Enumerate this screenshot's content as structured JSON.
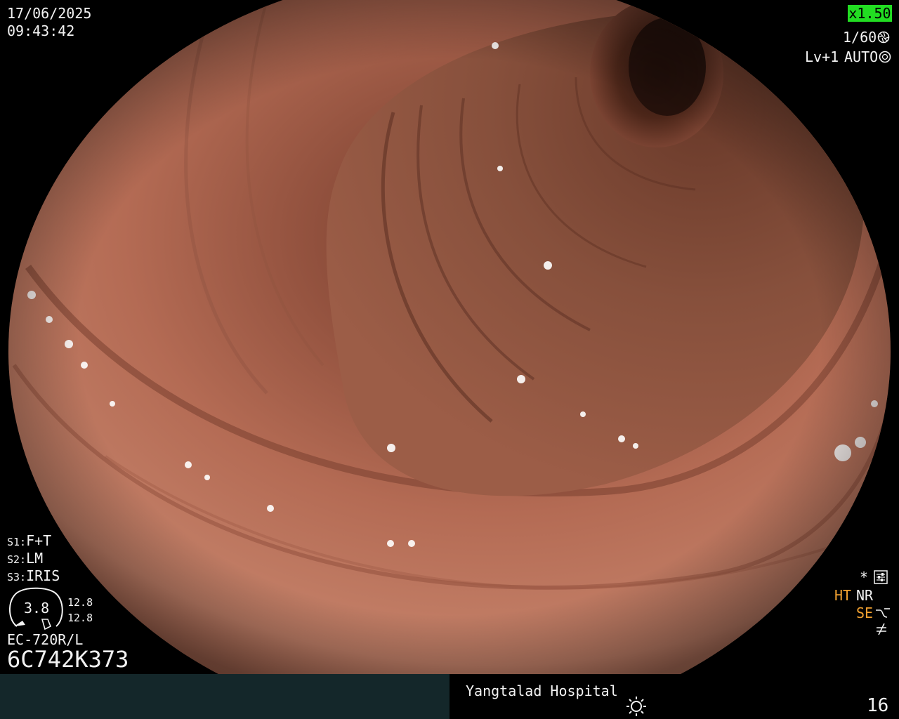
{
  "overlay": {
    "date": "17/06/2025",
    "time": "09:43:42",
    "zoom": "x1.50",
    "shutter": "1/60",
    "level": "Lv+1",
    "exposure_mode": "AUTO",
    "settings": [
      {
        "key": "S1:",
        "value": "F+T"
      },
      {
        "key": "S2:",
        "value": "LM"
      },
      {
        "key": "S3:",
        "value": "IRIS"
      }
    ],
    "iris_value": "3.8",
    "iris_right_top": "12.8",
    "iris_right_bottom": "12.8",
    "scope_model": "EC-720R/L",
    "scope_serial": "6C742K373",
    "star": "*",
    "ht_label": "HT",
    "nr_label": "NR",
    "se_label": "SE",
    "hospital": "Yangtalad Hospital",
    "frame_count": "16"
  },
  "icons": {
    "shutter": "aperture-icon",
    "exposure": "aperture-icon",
    "settings": "sliders-icon",
    "se": "curve-icon",
    "filter": "not-equal-icon",
    "light": "sun-icon"
  },
  "colors": {
    "zoom_badge": "#22dd22",
    "highlight_labels": "#f0a030",
    "bottom_bar": "#14272a",
    "tissue": "#b56a52"
  }
}
